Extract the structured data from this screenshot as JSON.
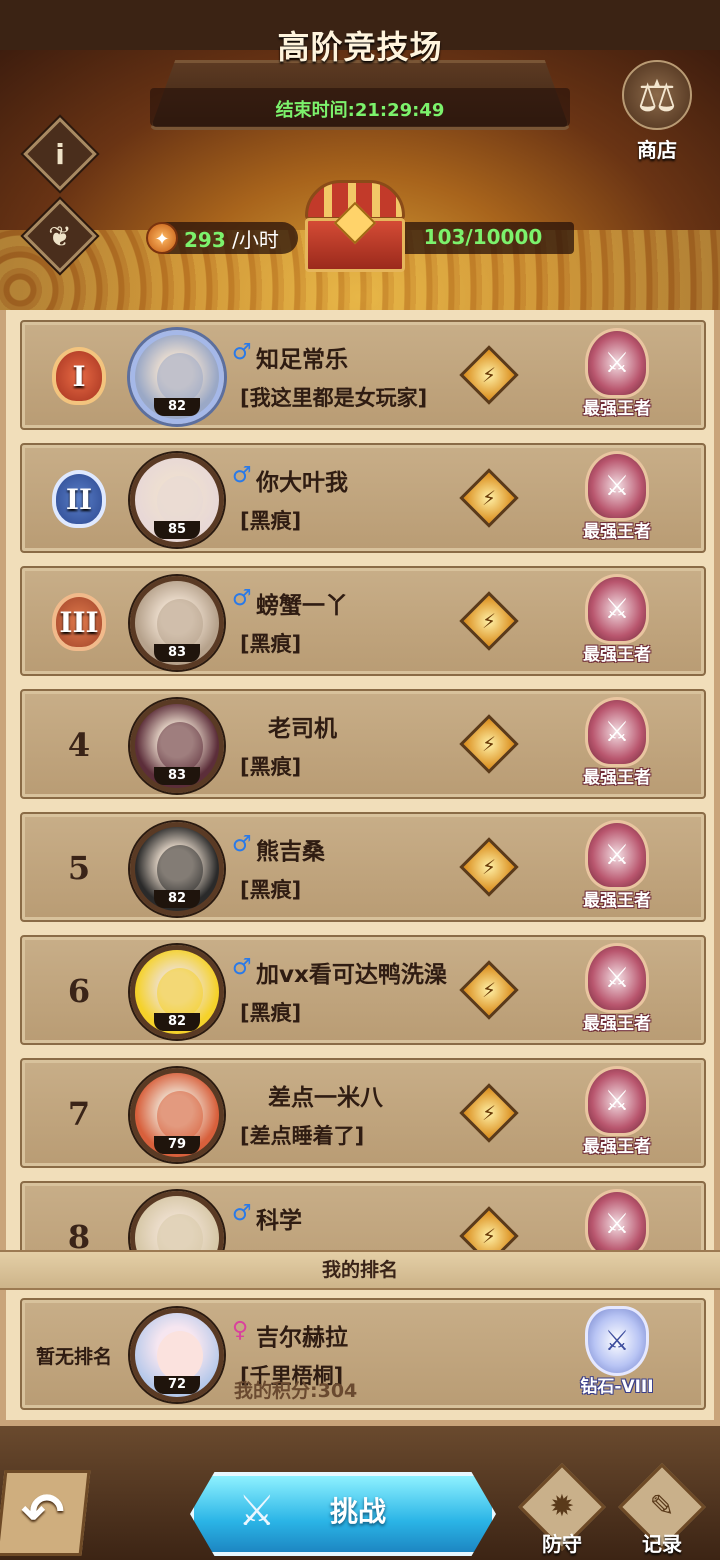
{
  "header": {
    "title": "高阶竞技场",
    "end_time": "结束时间:21:29:49",
    "shop_label": "商店",
    "rate_value": "293",
    "rate_unit": " /小时",
    "progress": "103/10000",
    "info_icon": "info-icon",
    "sprout_icon": "sprout-icon"
  },
  "rankings": [
    {
      "rank": "1",
      "gender": "♂",
      "name": "知足常乐",
      "guild": "[我这里都是女玩家]",
      "level": "82",
      "tier": "最强王者"
    },
    {
      "rank": "2",
      "gender": "♂",
      "name": "你大叶我",
      "guild": "[黑痕]",
      "level": "85",
      "tier": "最强王者"
    },
    {
      "rank": "3",
      "gender": "♂",
      "name": "螃蟹一丫",
      "guild": "[黑痕]",
      "level": "83",
      "tier": "最强王者"
    },
    {
      "rank": "4",
      "gender": "",
      "name": "老司机",
      "guild": "[黑痕]",
      "level": "83",
      "tier": "最强王者"
    },
    {
      "rank": "5",
      "gender": "♂",
      "name": "熊吉桑",
      "guild": "[黑痕]",
      "level": "82",
      "tier": "最强王者"
    },
    {
      "rank": "6",
      "gender": "♂",
      "name": "加vx看可达鸭洗澡",
      "guild": "[黑痕]",
      "level": "82",
      "tier": "最强王者"
    },
    {
      "rank": "7",
      "gender": "",
      "name": "差点一米八",
      "guild": "[差点睡着了]",
      "level": "79",
      "tier": "最强王者"
    },
    {
      "rank": "8",
      "gender": "♂",
      "name": "科学",
      "guild": "",
      "level": "",
      "tier": ""
    }
  ],
  "rank_badges": {
    "1": "I",
    "2": "II",
    "3": "III"
  },
  "my_ranking": {
    "section_title": "我的排名",
    "rank_text": "暂无排名",
    "gender": "♀",
    "name": "吉尔赫拉",
    "guild": "[千里梧桐]",
    "level": "72",
    "score": "我的积分:304",
    "tier": "钻石-VIII"
  },
  "bottom": {
    "challenge_label": "挑战",
    "defense_label": "防守",
    "record_label": "记录"
  },
  "colors": {
    "accent_green": "#7cf26c",
    "male_blue": "#2a7ae8",
    "female_pink": "#d9429c",
    "challenge_blue": "#2ab4e6"
  }
}
